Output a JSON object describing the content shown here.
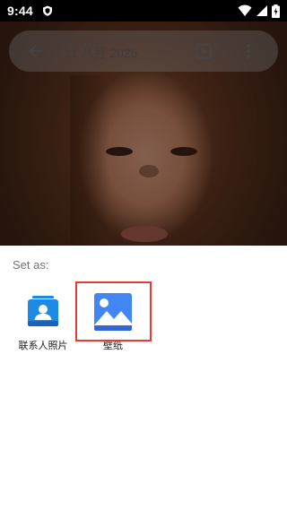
{
  "status_bar": {
    "time": "9:44",
    "icons": [
      "shield-icon",
      "wifi-icon",
      "signal-icon",
      "battery-charging-icon"
    ]
  },
  "app_bar": {
    "title": "11 八月 2025",
    "icons": [
      "arrow-back-icon",
      "slideshow-icon",
      "more-vert-icon"
    ]
  },
  "share_sheet": {
    "title": "Set as:",
    "targets": [
      {
        "label": "联系人照片",
        "icon": "contacts-icon"
      },
      {
        "label": "壁纸",
        "icon": "wallpaper-icon",
        "highlighted": true
      }
    ]
  },
  "colors": {
    "highlight_border": "#e53935",
    "contacts_blue": "#1e88e5",
    "wallpaper_blue": "#4285f4"
  }
}
